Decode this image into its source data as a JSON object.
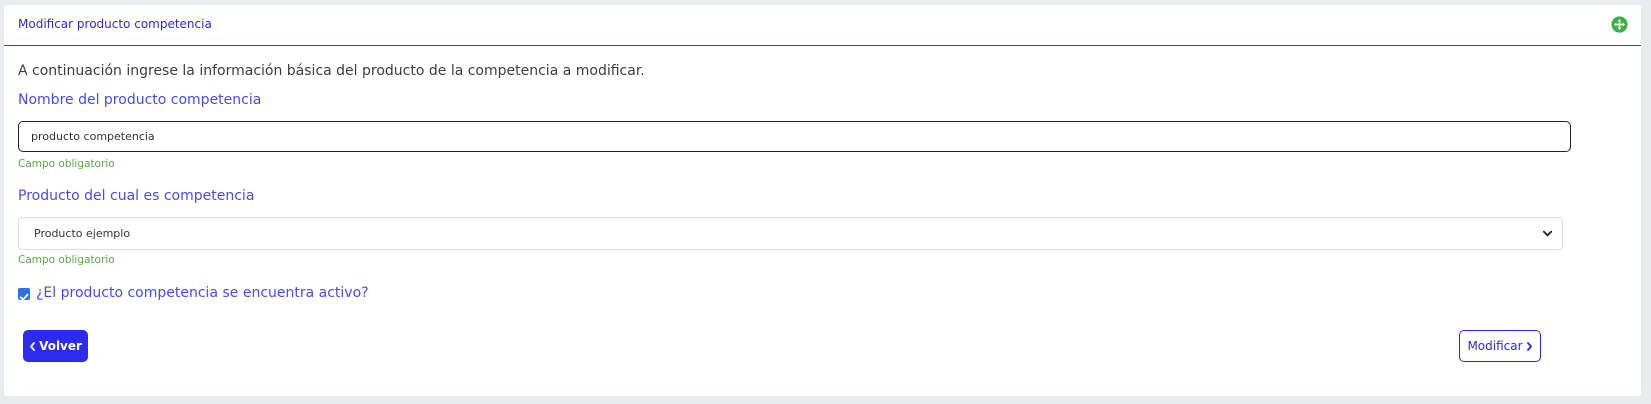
{
  "card": {
    "title": "Modificar producto competencia",
    "expand_icon": "expand-arrows-icon",
    "accent_color": "#2d2bf0",
    "success_color": "#59a845"
  },
  "form": {
    "intro": "A continuación ingrese la información básica del producto de la competencia a modificar.",
    "name_label": "Nombre del producto competencia",
    "name_value": "producto competencia",
    "name_help": "Campo obligatorio",
    "product_label": "Producto del cual es competencia",
    "product_selected": "Producto ejemplo",
    "product_help": "Campo obligatorio",
    "active_label": "¿El producto competencia se encuentra activo?",
    "active_checked": true
  },
  "actions": {
    "back_label": "Volver",
    "modify_label": "Modificar"
  }
}
